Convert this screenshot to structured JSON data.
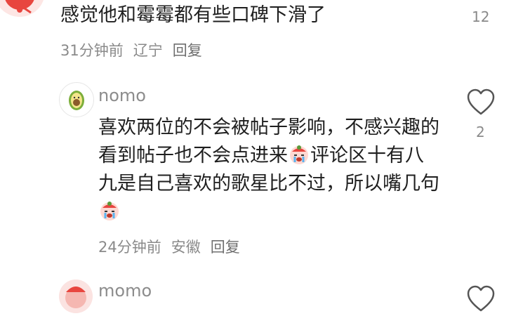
{
  "comments": [
    {
      "username": "",
      "text": "感觉他和霉霉都有些口碑下滑了",
      "time": "31分钟前",
      "location": "辽宁",
      "reply_label": "回复",
      "likes": "12",
      "avatar_icon": "red-character-avatar"
    },
    {
      "username": "nomo",
      "text_parts": [
        "喜欢两位的不会被帖子影响，不感兴趣的看到帖子也不会点进来",
        "评论区十有八九是自己喜欢的歌星比不过，所以嘴几句"
      ],
      "time": "24分钟前",
      "location": "安徽",
      "reply_label": "回复",
      "likes": "2",
      "avatar_icon": "avocado-icon",
      "inline_emojis": [
        "crying-face-emoji",
        "crying-face-emoji"
      ]
    },
    {
      "username": "momo",
      "avatar_icon": "pink-character-avatar"
    }
  ],
  "icons": {
    "like": "heart-outline-icon"
  },
  "colors": {
    "accent_red": "#e8463f",
    "meta_gray": "#8a8a8a",
    "avocado_green": "#7cae3a"
  }
}
